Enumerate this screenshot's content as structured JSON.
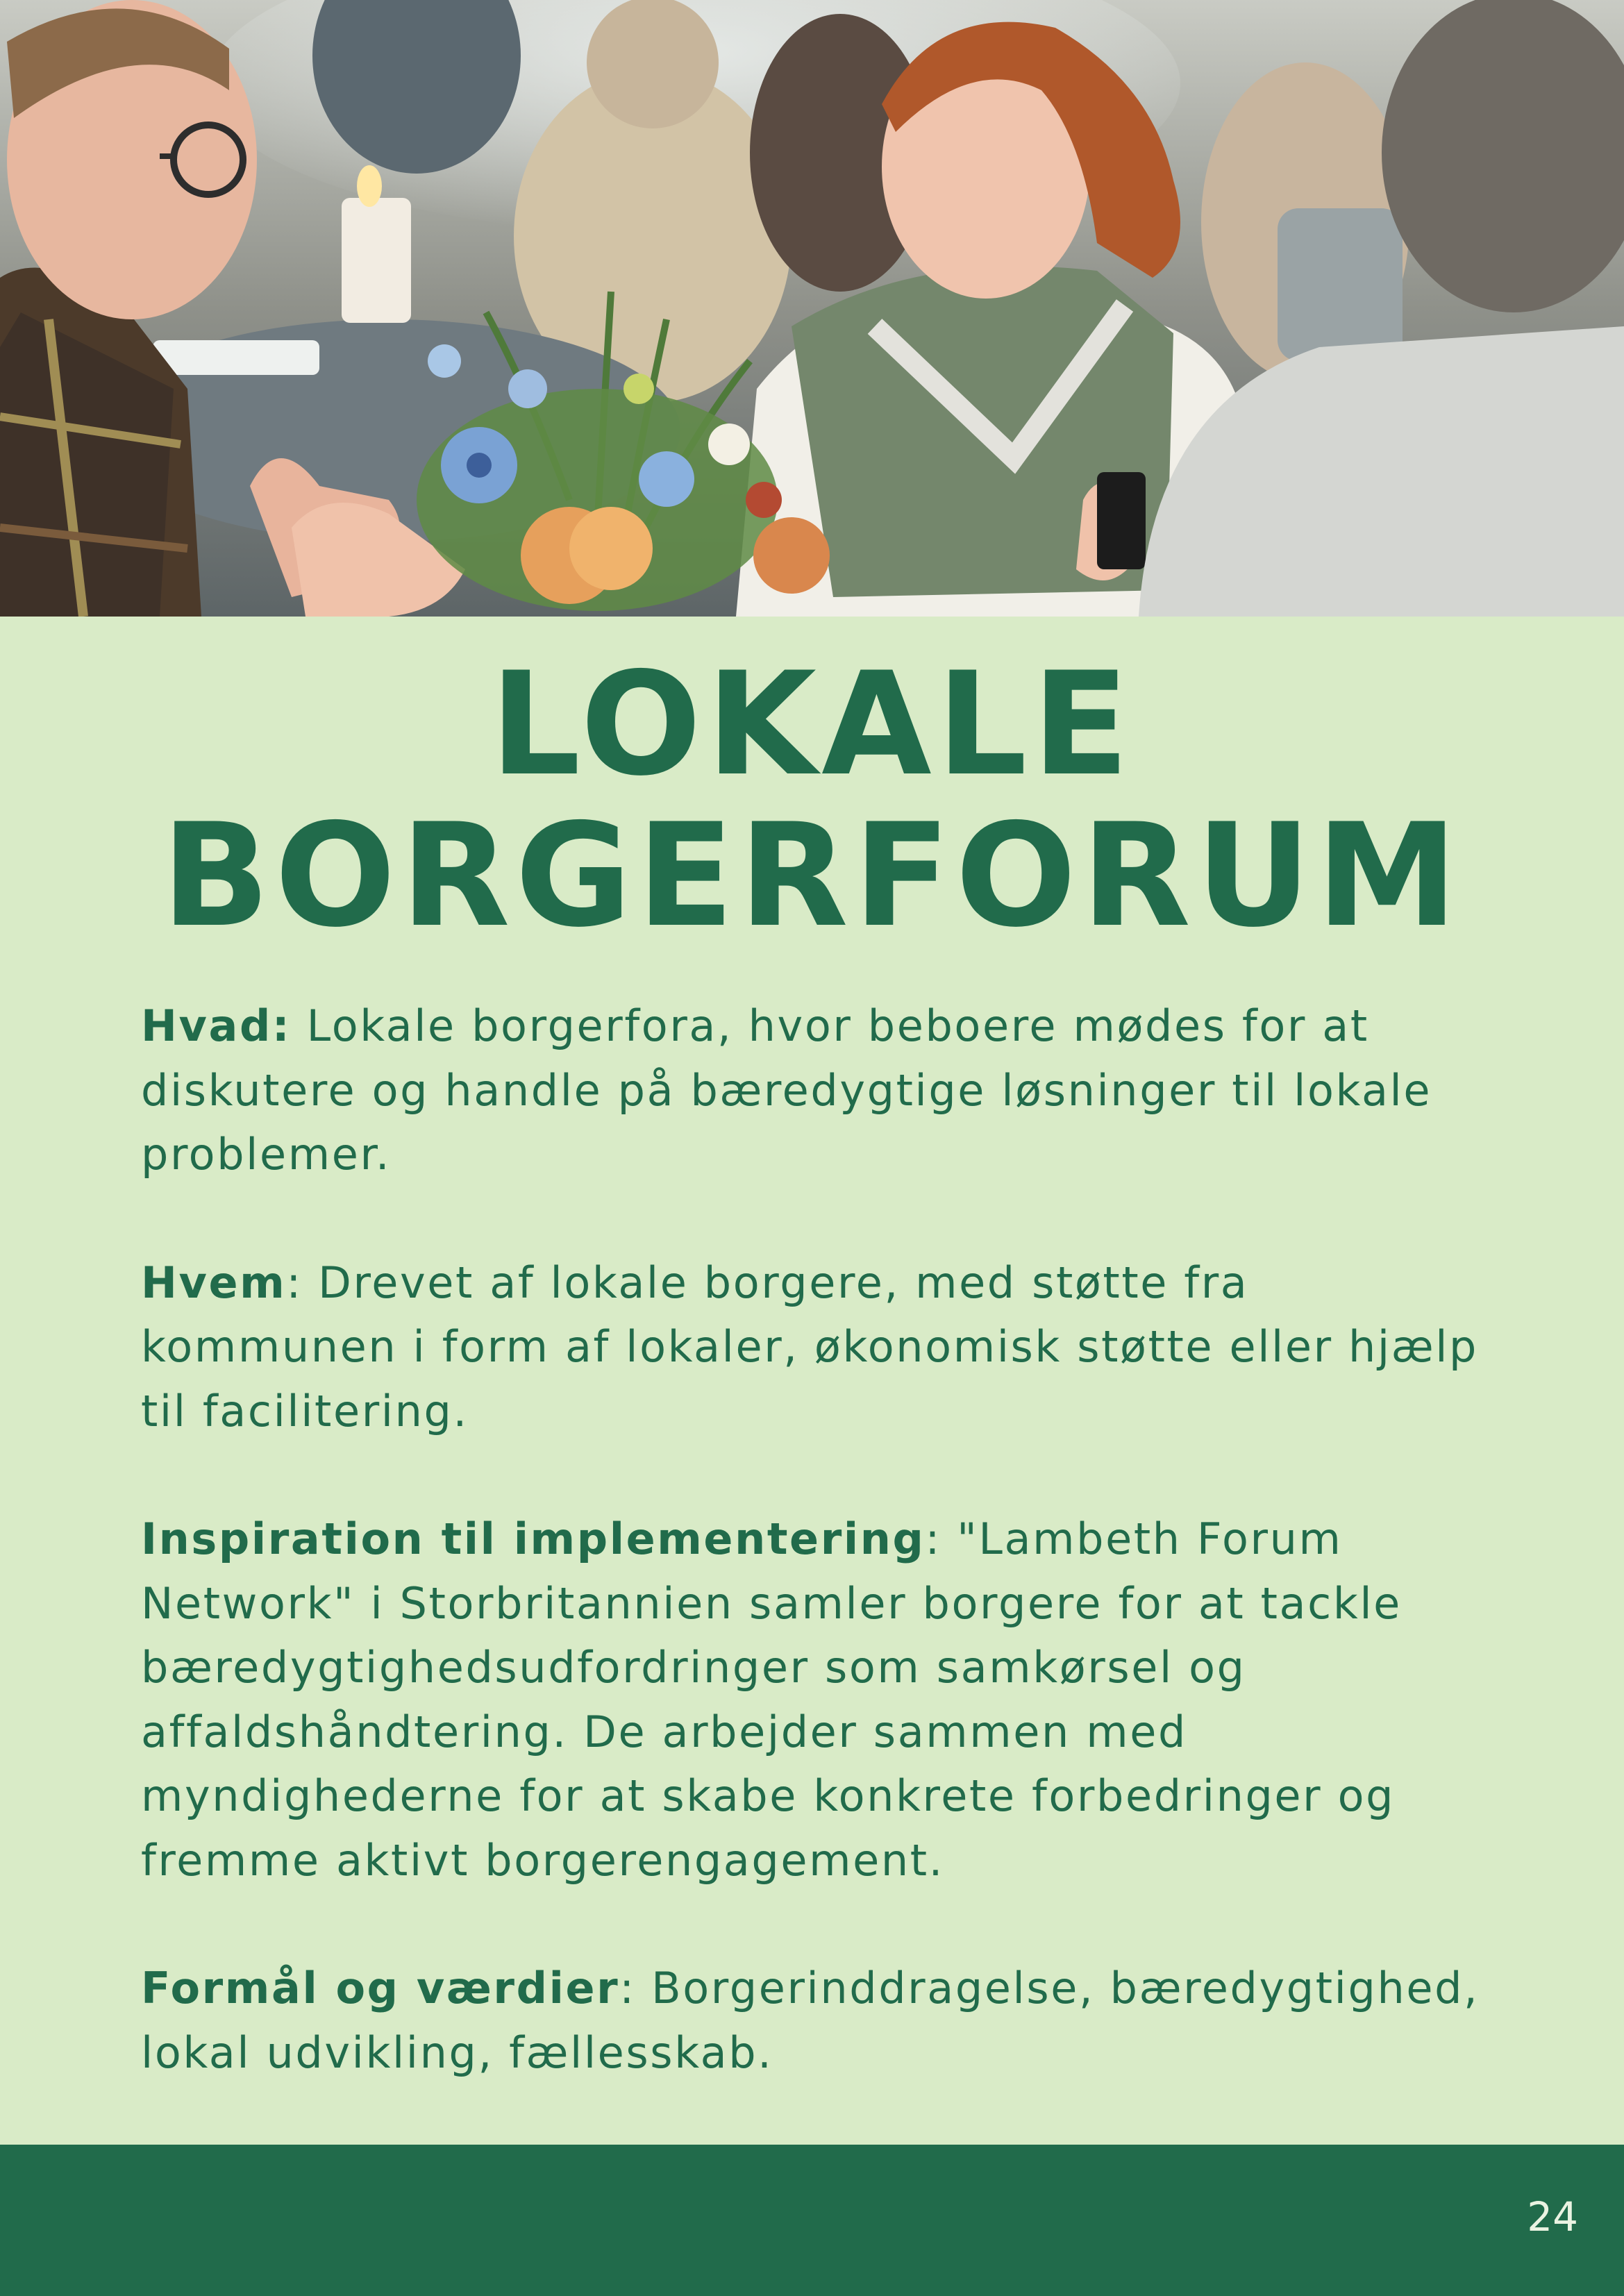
{
  "page": {
    "title_line1": "LOKALE",
    "title_line2": "BORGERFORUM",
    "page_number": "24"
  },
  "sections": [
    {
      "label": "Hvad:",
      "text": " Lokale borgerfora, hvor beboere mødes for at diskutere og handle på bæredygtige løsninger til lokale problemer."
    },
    {
      "label": "Hvem",
      "text": ": Drevet af lokale borgere, med støtte fra kommunen i form af lokaler, økonomisk støtte eller hjælp til facilitering."
    },
    {
      "label": "Inspiration til implementering",
      "text": ": \"Lambeth Forum Network\" i Storbritannien samler borgere for at tackle bæredygtighedsudfordringer som samkørsel og affaldshåndtering. De arbejder sammen med myndighederne for at skabe konkrete forbedringer og fremme aktivt borgerengagement."
    },
    {
      "label": "Formål og værdier",
      "text": ": Borgerinddragelse, bæredygtighed, lokal udvikling, fællesskab."
    }
  ],
  "colors": {
    "background": "#d9ebc7",
    "accent": "#216b4b",
    "footer_text": "#eaf3e2"
  }
}
